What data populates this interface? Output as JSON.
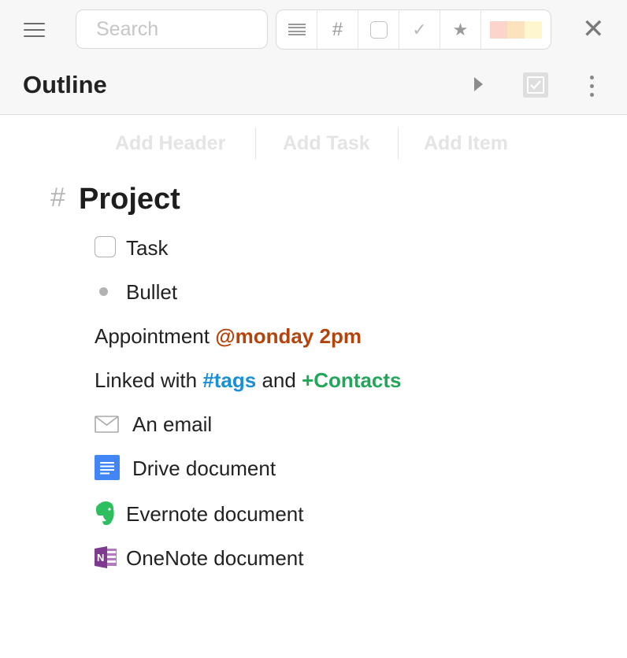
{
  "toolbar": {
    "search_placeholder": "Search",
    "filters": [
      {
        "name": "list-filter-icon"
      },
      {
        "name": "hash-filter",
        "glyph": "#"
      },
      {
        "name": "task-filter-icon"
      },
      {
        "name": "done-filter",
        "glyph": "✓"
      },
      {
        "name": "star-filter",
        "glyph": "★"
      },
      {
        "name": "color-filter",
        "colors": [
          "#fcd4cc",
          "#fde3bd",
          "#fdf6cf"
        ]
      }
    ],
    "close_glyph": "✕"
  },
  "header": {
    "title": "Outline"
  },
  "add_bar": {
    "header_label": "Add Header",
    "task_label": "Add Task",
    "item_label": "Add Item"
  },
  "outline": {
    "project_hash": "#",
    "project_title": "Project",
    "task_label": "Task",
    "bullet_label": "Bullet",
    "appointment_text": "Appointment ",
    "appointment_date": "@monday 2pm",
    "linked_prefix": "Linked with ",
    "linked_tag": "#tags",
    "linked_and": " and ",
    "linked_contact": "+Contacts",
    "email_label": "An email",
    "drive_label": "Drive document",
    "evernote_label": "Evernote document",
    "onenote_label": "OneNote document"
  },
  "colors": {
    "date": "#b5430c",
    "tag": "#1a8fd6",
    "contact": "#22a65a",
    "drive": "#4285f4",
    "evernote": "#2dbe60",
    "onenote": "#7e3a8e"
  }
}
